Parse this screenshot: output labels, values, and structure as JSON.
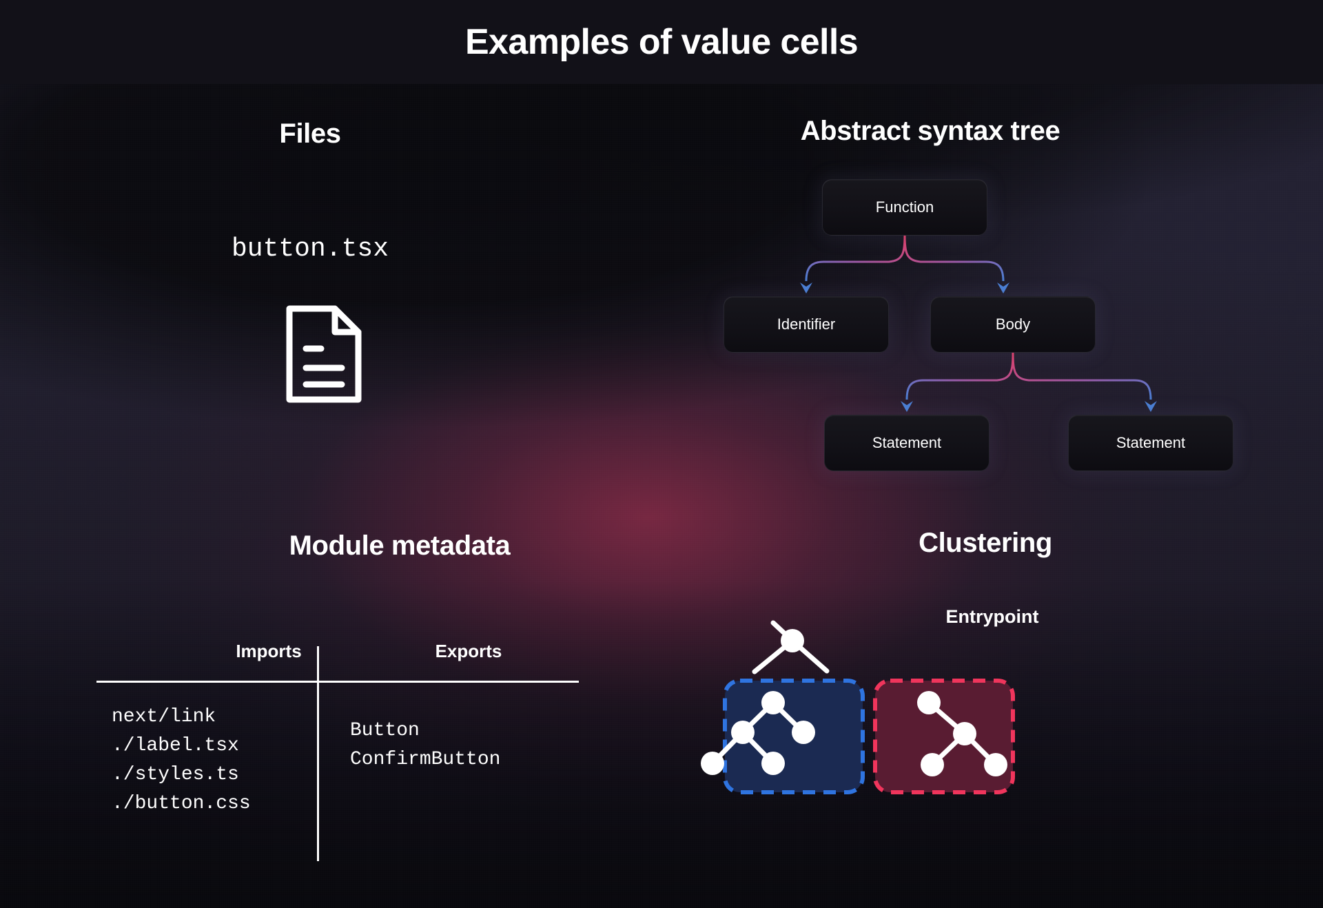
{
  "page": {
    "title": "Examples of value cells",
    "bg_color": "#1d1b29",
    "title_bar_color": "#121118"
  },
  "sections": {
    "files": {
      "heading": "Files",
      "filename": "button.tsx",
      "icon": "file-document-icon"
    },
    "ast": {
      "heading": "Abstract syntax tree",
      "nodes": [
        {
          "id": "function",
          "label": "Function"
        },
        {
          "id": "identifier",
          "label": "Identifier"
        },
        {
          "id": "body",
          "label": "Body"
        },
        {
          "id": "statement1",
          "label": "Statement"
        },
        {
          "id": "statement2",
          "label": "Statement"
        }
      ],
      "edges": [
        {
          "from": "function",
          "to": "identifier"
        },
        {
          "from": "function",
          "to": "body"
        },
        {
          "from": "body",
          "to": "statement1"
        },
        {
          "from": "body",
          "to": "statement2"
        }
      ],
      "edge_color_start": "#e0406a",
      "edge_color_end": "#4a7fd4"
    },
    "module_metadata": {
      "heading": "Module metadata",
      "columns": [
        "Imports",
        "Exports"
      ],
      "imports": [
        "next/link",
        "./label.tsx",
        "./styles.ts",
        "./button.css"
      ],
      "exports": [
        "Button",
        "ConfirmButton"
      ]
    },
    "clustering": {
      "heading": "Clustering",
      "entrypoint_label": "Entrypoint",
      "node_color": "#ffffff",
      "clusters": [
        {
          "id": "cluster-blue",
          "border_color": "#2f74e0",
          "fill_color": "#1b2a52",
          "node_count": 5
        },
        {
          "id": "cluster-red",
          "border_color": "#f0355c",
          "fill_color": "#591c32",
          "node_count": 4
        }
      ]
    }
  }
}
